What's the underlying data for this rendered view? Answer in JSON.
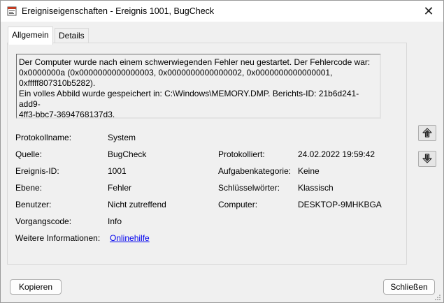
{
  "window": {
    "title": "Ereigniseigenschaften - Ereignis 1001, BugCheck",
    "close_glyph": "✕"
  },
  "tabs": [
    {
      "label": "Allgemein",
      "active": true
    },
    {
      "label": "Details",
      "active": false
    }
  ],
  "description": {
    "line1": "Der Computer wurde nach einem schwerwiegenden Fehler neu gestartet. Der Fehlercode war:",
    "line2": "0x0000000a (0x0000000000000003, 0x0000000000000002, 0x0000000000000001, 0xfffff807310b5282).",
    "line3": "Ein volles Abbild wurde gespeichert in: C:\\Windows\\MEMORY.DMP. Berichts-ID: 21b6d241-add9-",
    "line4": "4ff3-bbc7-3694768137d3."
  },
  "fields": {
    "protokollname": {
      "label": "Protokollname:",
      "value": "System"
    },
    "quelle": {
      "label": "Quelle:",
      "value": "BugCheck"
    },
    "protokolliert": {
      "label": "Protokolliert:",
      "value": "24.02.2022 19:59:42"
    },
    "ereignis_id": {
      "label": "Ereignis-ID:",
      "value": "1001"
    },
    "aufgabenkategorie": {
      "label": "Aufgabenkategorie:",
      "value": "Keine"
    },
    "ebene": {
      "label": "Ebene:",
      "value": "Fehler"
    },
    "schluesselwoerter": {
      "label": "Schlüsselwörter:",
      "value": "Klassisch"
    },
    "benutzer": {
      "label": "Benutzer:",
      "value": "Nicht zutreffend"
    },
    "computer": {
      "label": "Computer:",
      "value": "DESKTOP-9MHKBGA"
    },
    "vorgangscode": {
      "label": "Vorgangscode:",
      "value": "Info"
    },
    "weitere_info": {
      "label": "Weitere Informationen:",
      "value": "Onlinehilfe"
    }
  },
  "buttons": {
    "copy": "Kopieren",
    "close": "Schließen"
  },
  "icons": {
    "up": "arrow-up-icon",
    "down": "arrow-down-icon"
  }
}
